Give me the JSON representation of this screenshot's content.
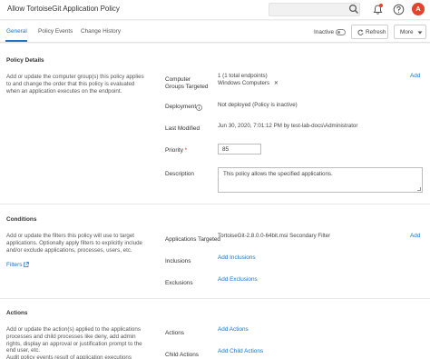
{
  "header": {
    "title": "Allow TortoiseGit Application Policy",
    "avatar_letter": "A",
    "icons": [
      "search-icon",
      "bell-icon",
      "help-icon"
    ],
    "colors": {
      "accent": "#1a73c9",
      "alert": "#e0442c"
    }
  },
  "tabs": {
    "general": "General",
    "policy_events": "Policy Events",
    "change_history": "Change History"
  },
  "toolbar": {
    "status_label": "Inactive",
    "refresh_label": "Refresh",
    "more_label": "More"
  },
  "policy_details": {
    "title": "Policy Details",
    "description": "Add or update the computer group(s) this policy applies to and change the order that this policy is evaluated when an application executes on the endpoint.",
    "computer_groups_label": "Computer Groups Targeted",
    "computer_groups_count": "1 (1 total endpoints)",
    "computer_groups_item": "Windows Computers",
    "add_label": "Add",
    "deployment_label": "Deployment",
    "deployment_value": "Not deployed (Policy is inactive)",
    "last_modified_label": "Last Modified",
    "last_modified_value": "Jun 30, 2020, 7:01:12 PM by test-lab-docs\\Administrator",
    "priority_label": "Priority",
    "priority_required": "*",
    "priority_value": "85",
    "description_label": "Description",
    "description_value": "This policy allows the specified applications."
  },
  "conditions": {
    "title": "Conditions",
    "description": "Add or update the filters this policy will use to target applications. Optionally apply filters to explicitly include and/or exclude applications, processes, users, etc.",
    "filters_link": "Filters",
    "apps_targeted_label": "Applications Targeted",
    "apps_targeted_value": "TortoiseGit-2.8.0.0-64bit.msi Secondary Filter",
    "add_label": "Add",
    "inclusions_label": "Inclusions",
    "add_inclusions": "Add Inclusions",
    "exclusions_label": "Exclusions",
    "add_exclusions": "Add Exclusions"
  },
  "actions": {
    "title": "Actions",
    "description": "Add or update the action(s) applied to the applications processes and child processes like deny, add admin rights, display an approval or justification prompt to the end user, etc.",
    "description_cut": "Audit policy events result of application executions",
    "actions_label": "Actions",
    "add_actions": "Add Actions",
    "child_actions_label": "Child Actions",
    "add_child_actions": "Add Child Actions"
  }
}
